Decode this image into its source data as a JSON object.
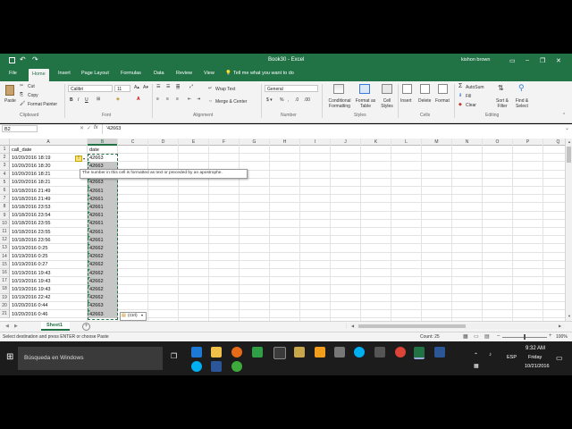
{
  "window": {
    "title": "Book30 - Excel",
    "user": "kishon brown"
  },
  "tabs": [
    "File",
    "Home",
    "Insert",
    "Page Layout",
    "Formulas",
    "Data",
    "Review",
    "View"
  ],
  "tell_me": "Tell me what you want to do",
  "ribbon": {
    "paste": "Paste",
    "cut": "Cut",
    "copy": "Copy",
    "format_painter": "Format Painter",
    "clipboard_label": "Clipboard",
    "font_name": "Calibri",
    "font_size": "11",
    "font_label": "Font",
    "wrap_text": "Wrap Text",
    "merge_center": "Merge & Center",
    "alignment_label": "Alignment",
    "number_format": "General",
    "number_label": "Number",
    "conditional_formatting": "Conditional Formatting",
    "format_as_table": "Format as Table",
    "cell_styles": "Cell Styles",
    "styles_label": "Styles",
    "insert": "Insert",
    "delete": "Delete",
    "format": "Format",
    "cells_label": "Cells",
    "autosum": "AutoSum",
    "fill": "Fill",
    "clear": "Clear",
    "sort_filter": "Sort & Filter",
    "find_select": "Find & Select",
    "editing_label": "Editing"
  },
  "formula_bar": {
    "name_box": "B2",
    "fx": "fx",
    "value": "'42663"
  },
  "columns": [
    "A",
    "B",
    "C",
    "D",
    "E",
    "F",
    "G",
    "H",
    "I",
    "J",
    "K",
    "L",
    "M",
    "N",
    "O",
    "P",
    "Q"
  ],
  "rows": [
    {
      "n": "1",
      "a": "call_date",
      "b": "date"
    },
    {
      "n": "2",
      "a": "10/20/2016 18:19",
      "b": "42663"
    },
    {
      "n": "3",
      "a": "10/20/2016 18:20",
      "b": "42663"
    },
    {
      "n": "4",
      "a": "10/20/2016 18:21",
      "b": "42663"
    },
    {
      "n": "5",
      "a": "10/20/2016 18:21",
      "b": "42663"
    },
    {
      "n": "6",
      "a": "10/18/2016 21:49",
      "b": "42661"
    },
    {
      "n": "7",
      "a": "10/18/2016 21:49",
      "b": "42661"
    },
    {
      "n": "8",
      "a": "10/18/2016 23:53",
      "b": "42661"
    },
    {
      "n": "9",
      "a": "10/18/2016 23:54",
      "b": "42661"
    },
    {
      "n": "10",
      "a": "10/18/2016 23:55",
      "b": "42661"
    },
    {
      "n": "11",
      "a": "10/18/2016 23:55",
      "b": "42661"
    },
    {
      "n": "12",
      "a": "10/18/2016 23:56",
      "b": "42661"
    },
    {
      "n": "13",
      "a": "10/19/2016 0:25",
      "b": "42662"
    },
    {
      "n": "14",
      "a": "10/19/2016 0:25",
      "b": "42662"
    },
    {
      "n": "15",
      "a": "10/19/2016 0:27",
      "b": "42662"
    },
    {
      "n": "16",
      "a": "10/19/2016 19:43",
      "b": "42662"
    },
    {
      "n": "17",
      "a": "10/19/2016 19:43",
      "b": "42662"
    },
    {
      "n": "18",
      "a": "10/19/2016 19:43",
      "b": "42662"
    },
    {
      "n": "19",
      "a": "10/19/2016 22:42",
      "b": "42662"
    },
    {
      "n": "20",
      "a": "10/20/2016 0:44",
      "b": "42663"
    },
    {
      "n": "21",
      "a": "10/20/2016 0:46",
      "b": "42663"
    }
  ],
  "tooltip": "The number in this cell is formatted as text or preceded by an apostrophe.",
  "paste_options": "(Ctrl)",
  "sheet_tab": "Sheet1",
  "status": {
    "message": "Select destination and press ENTER or choose Paste",
    "count": "Count: 25",
    "zoom": "100%"
  },
  "taskbar": {
    "search_placeholder": "Búsqueda en Windows",
    "language": "ESP",
    "time": "9:32 AM",
    "day": "Friday",
    "date": "10/21/2016"
  },
  "colors": {
    "excel_green": "#217346",
    "selection_border": "#217346",
    "error_flag": "#2e8b57"
  }
}
